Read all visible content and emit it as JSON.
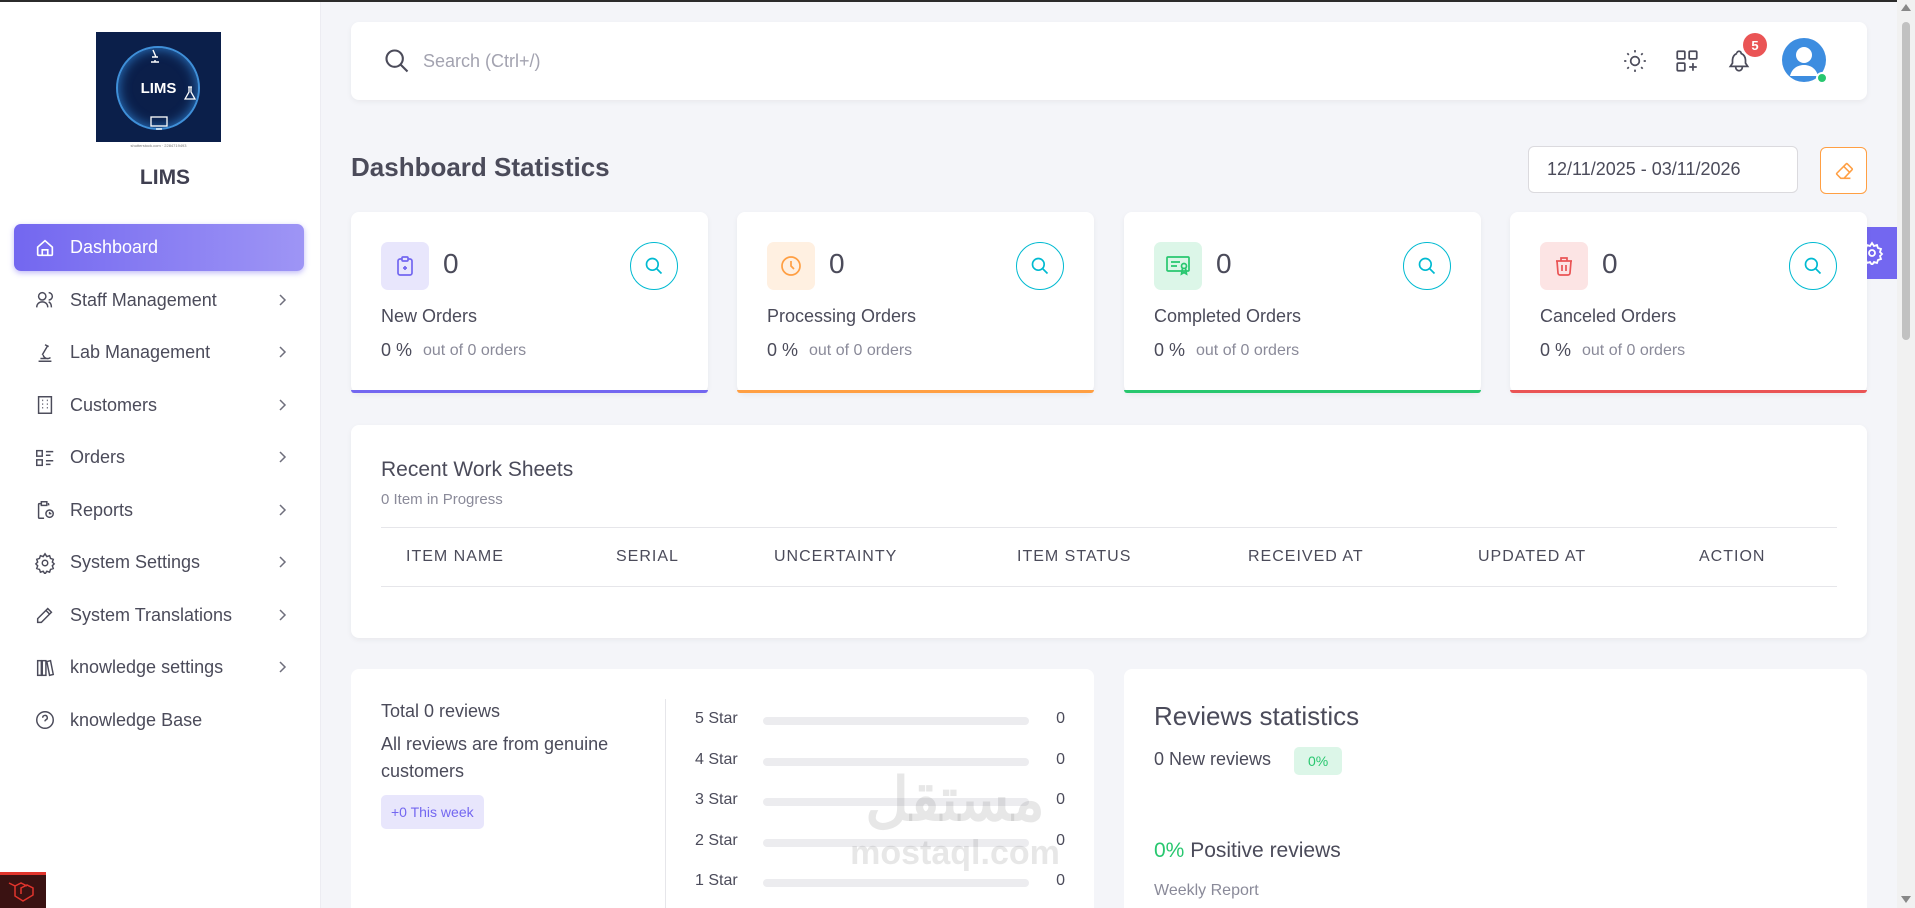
{
  "brand": {
    "logo_text": "LIMS",
    "logo_footer": "shutterstock.com · 2284719493",
    "name": "LIMS"
  },
  "sidebar": {
    "items": [
      {
        "label": "Dashboard",
        "icon": "home-icon",
        "active": true,
        "has_submenu": false
      },
      {
        "label": "Staff Management",
        "icon": "users-icon",
        "has_submenu": true
      },
      {
        "label": "Lab Management",
        "icon": "microscope-icon",
        "has_submenu": true
      },
      {
        "label": "Customers",
        "icon": "building-icon",
        "has_submenu": true
      },
      {
        "label": "Orders",
        "icon": "list-details-icon",
        "has_submenu": true
      },
      {
        "label": "Reports",
        "icon": "report-icon",
        "has_submenu": true
      },
      {
        "label": "System Settings",
        "icon": "settings-icon",
        "has_submenu": true
      },
      {
        "label": "System Translations",
        "icon": "pencil-icon",
        "has_submenu": true
      },
      {
        "label": "knowledge settings",
        "icon": "books-icon",
        "has_submenu": true
      },
      {
        "label": "knowledge Base",
        "icon": "help-circle-icon",
        "has_submenu": false
      }
    ]
  },
  "topbar": {
    "search_placeholder": "Search (Ctrl+/)",
    "notification_count": "5",
    "icons": [
      "sun-icon",
      "apps-icon",
      "bell-icon",
      "user-avatar-icon"
    ]
  },
  "header": {
    "title": "Dashboard Statistics",
    "date_range": "12/11/2025 - 03/11/2026"
  },
  "stats": [
    {
      "count": "0",
      "label": "New Orders",
      "percent": "0 %",
      "subtext": "out of 0 orders",
      "color": "#7367f0",
      "icon": "clipboard-icon"
    },
    {
      "count": "0",
      "label": "Processing Orders",
      "percent": "0 %",
      "subtext": "out of 0 orders",
      "color": "#ff9f43",
      "icon": "clock-icon"
    },
    {
      "count": "0",
      "label": "Completed Orders",
      "percent": "0 %",
      "subtext": "out of 0 orders",
      "color": "#28c76f",
      "icon": "certificate-icon"
    },
    {
      "count": "0",
      "label": "Canceled Orders",
      "percent": "0 %",
      "subtext": "out of 0 orders",
      "color": "#ea5455",
      "icon": "trash-icon"
    }
  ],
  "worksheets": {
    "title": "Recent Work Sheets",
    "subtitle": "0 Item in Progress",
    "columns": [
      "ITEM NAME",
      "SERIAL",
      "UNCERTAINTY",
      "ITEM STATUS",
      "RECEIVED AT",
      "UPDATED AT",
      "ACTION"
    ],
    "rows": []
  },
  "reviews": {
    "total": "Total 0 reviews",
    "description": "All reviews are from genuine customers",
    "week_badge": "+0 This week",
    "breakdown": [
      {
        "label": "5 Star",
        "count": "0",
        "fraction": 0
      },
      {
        "label": "4 Star",
        "count": "0",
        "fraction": 0
      },
      {
        "label": "3 Star",
        "count": "0",
        "fraction": 0
      },
      {
        "label": "2 Star",
        "count": "0",
        "fraction": 0
      },
      {
        "label": "1 Star",
        "count": "0",
        "fraction": 0
      }
    ]
  },
  "review_stats": {
    "title": "Reviews statistics",
    "new_reviews": "0 New reviews",
    "new_badge": "0%",
    "positive_value": "0%",
    "positive_label": "Positive reviews",
    "weekly_report": "Weekly Report"
  },
  "watermark": {
    "arabic": "مستقل",
    "latin": "mostaql.com"
  },
  "colors": {
    "primary": "#7367f0",
    "warning": "#ff9f43",
    "success": "#28c76f",
    "danger": "#ea5455",
    "info": "#00bad1"
  }
}
